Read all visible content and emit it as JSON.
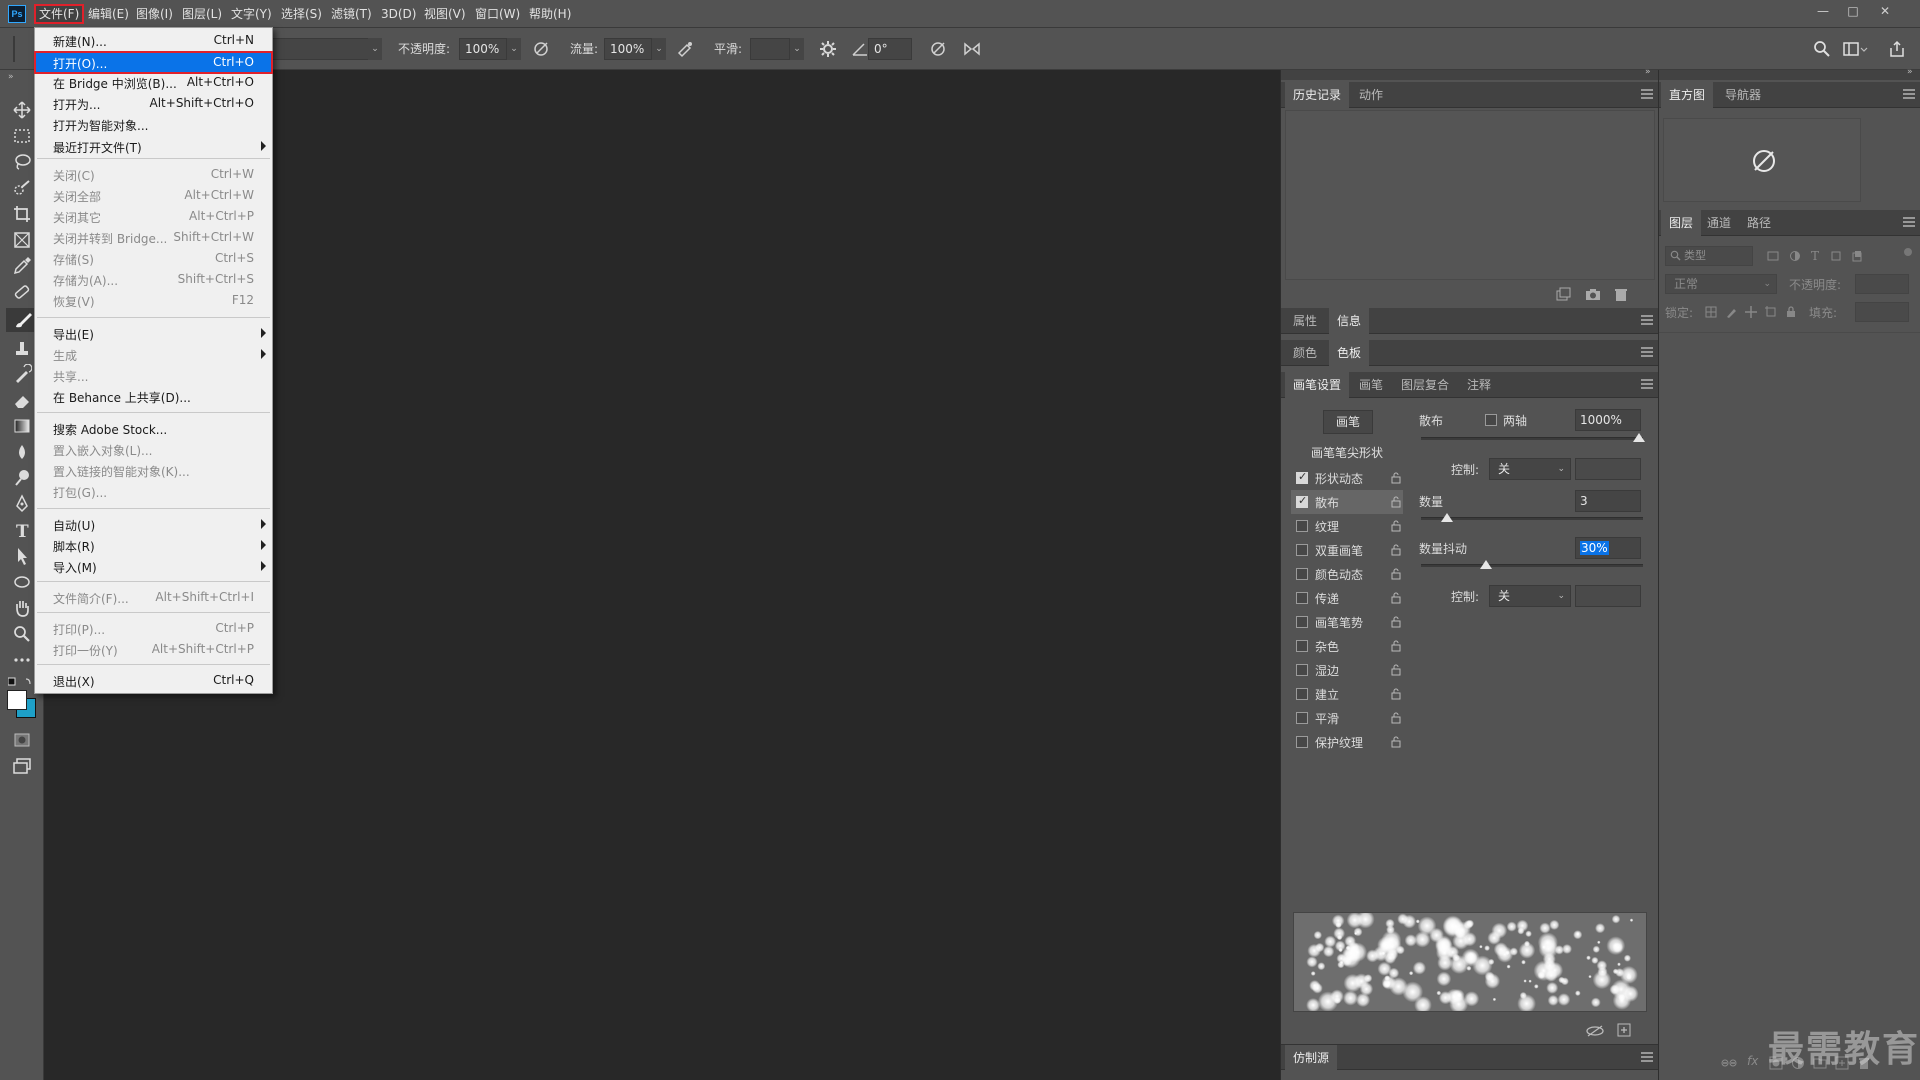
{
  "app": {
    "logo_text": "Ps"
  },
  "menubar": {
    "items": [
      "文件(F)",
      "编辑(E)",
      "图像(I)",
      "图层(L)",
      "文字(Y)",
      "选择(S)",
      "滤镜(T)",
      "3D(D)",
      "视图(V)",
      "窗口(W)",
      "帮助(H)"
    ],
    "window_controls": [
      "—",
      "□",
      "✕"
    ]
  },
  "options": {
    "opacity_label": "不透明度:",
    "opacity_value": "100%",
    "flow_label": "流量:",
    "flow_value": "100%",
    "smooth_label": "平滑:",
    "angle_value": "0°"
  },
  "file_menu": {
    "items": [
      {
        "label": "新建(N)...",
        "shortcut": "Ctrl+N"
      },
      {
        "label": "打开(O)...",
        "shortcut": "Ctrl+O"
      },
      {
        "label": "在 Bridge 中浏览(B)...",
        "shortcut": "Alt+Ctrl+O"
      },
      {
        "label": "打开为...",
        "shortcut": "Alt+Shift+Ctrl+O"
      },
      {
        "label": "打开为智能对象...",
        "shortcut": ""
      },
      {
        "label": "最近打开文件(T)",
        "shortcut": ""
      },
      {
        "label": "关闭(C)",
        "shortcut": "Ctrl+W"
      },
      {
        "label": "关闭全部",
        "shortcut": "Alt+Ctrl+W"
      },
      {
        "label": "关闭其它",
        "shortcut": "Alt+Ctrl+P"
      },
      {
        "label": "关闭并转到 Bridge...",
        "shortcut": "Shift+Ctrl+W"
      },
      {
        "label": "存储(S)",
        "shortcut": "Ctrl+S"
      },
      {
        "label": "存储为(A)...",
        "shortcut": "Shift+Ctrl+S"
      },
      {
        "label": "恢复(V)",
        "shortcut": "F12"
      },
      {
        "label": "导出(E)",
        "shortcut": ""
      },
      {
        "label": "生成",
        "shortcut": ""
      },
      {
        "label": "共享...",
        "shortcut": ""
      },
      {
        "label": "在 Behance 上共享(D)...",
        "shortcut": ""
      },
      {
        "label": "搜索 Adobe Stock...",
        "shortcut": ""
      },
      {
        "label": "置入嵌入对象(L)...",
        "shortcut": ""
      },
      {
        "label": "置入链接的智能对象(K)...",
        "shortcut": ""
      },
      {
        "label": "打包(G)...",
        "shortcut": ""
      },
      {
        "label": "自动(U)",
        "shortcut": ""
      },
      {
        "label": "脚本(R)",
        "shortcut": ""
      },
      {
        "label": "导入(M)",
        "shortcut": ""
      },
      {
        "label": "文件简介(F)...",
        "shortcut": "Alt+Shift+Ctrl+I"
      },
      {
        "label": "打印(P)...",
        "shortcut": "Ctrl+P"
      },
      {
        "label": "打印一份(Y)",
        "shortcut": "Alt+Shift+Ctrl+P"
      },
      {
        "label": "退出(X)",
        "shortcut": "Ctrl+Q"
      }
    ]
  },
  "panels": {
    "history_tabs": [
      "历史记录",
      "动作"
    ],
    "info_tabs": [
      "属性",
      "信息"
    ],
    "swatch_tabs": [
      "颜色",
      "色板"
    ],
    "brush_tabs": [
      "画笔设置",
      "画笔",
      "图层复合",
      "注释"
    ],
    "clone_tab": "仿制源",
    "histogram_tabs": [
      "直方图",
      "导航器"
    ],
    "layers_tabs": [
      "图层",
      "通道",
      "路径"
    ],
    "layers_search_placeholder": "类型",
    "blend_mode": "正常",
    "opacity_label": "不透明度:",
    "lock_label": "锁定:",
    "fill_label": "填充:"
  },
  "brush_settings": {
    "brush_button": "画笔",
    "tip_shape": "画笔笔尖形状",
    "list": [
      {
        "label": "形状动态",
        "checked": true
      },
      {
        "label": "散布",
        "checked": true
      },
      {
        "label": "纹理",
        "checked": false
      },
      {
        "label": "双重画笔",
        "checked": false
      },
      {
        "label": "颜色动态",
        "checked": false
      },
      {
        "label": "传递",
        "checked": false
      },
      {
        "label": "画笔笔势",
        "checked": false
      },
      {
        "label": "杂色",
        "checked": false
      },
      {
        "label": "湿边",
        "checked": false
      },
      {
        "label": "建立",
        "checked": false
      },
      {
        "label": "平滑",
        "checked": false
      },
      {
        "label": "保护纹理",
        "checked": false
      }
    ],
    "scatter_label": "散布",
    "both_axes_label": "两轴",
    "scatter_value": "1000%",
    "control_label": "控制:",
    "control_value": "关",
    "count_label": "数量",
    "count_value": "3",
    "count_jitter_label": "数量抖动",
    "count_jitter_value": "30%",
    "control2_label": "控制:",
    "control2_value": "关"
  },
  "watermark": "最需教育",
  "colors": {
    "accent": "#0a73e8",
    "highlight_border": "#e0212b",
    "foreground": "#ffffff",
    "background": "#1ea0c8"
  }
}
